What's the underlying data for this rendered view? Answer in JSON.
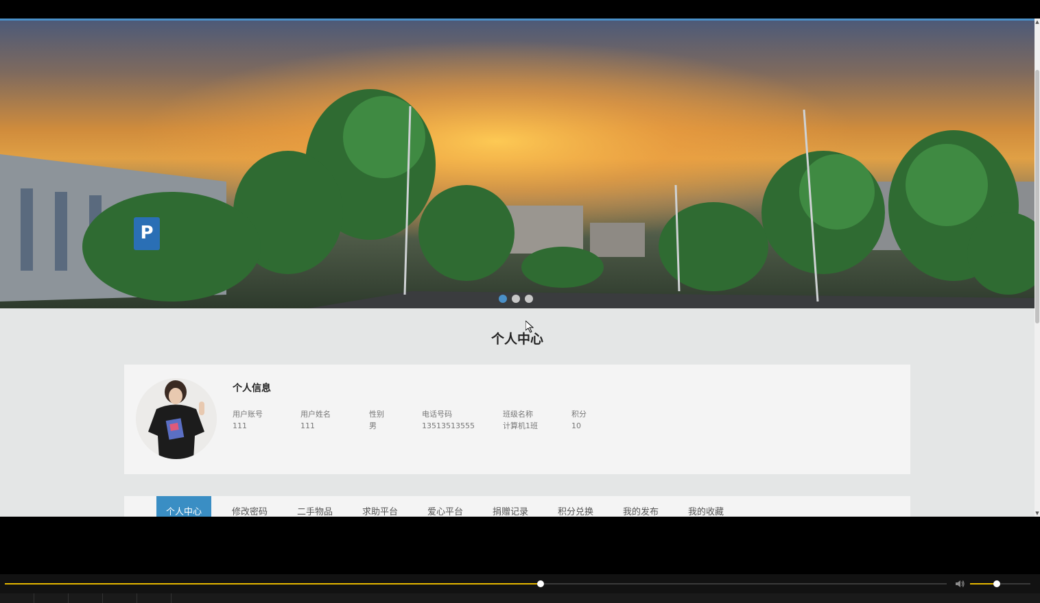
{
  "page": {
    "section_title": "个人中心",
    "carousel": {
      "slide_count": 3,
      "active_index": 0
    }
  },
  "profile": {
    "heading": "个人信息",
    "fields": [
      {
        "label": "用户账号",
        "value": "111"
      },
      {
        "label": "用户姓名",
        "value": "111"
      },
      {
        "label": "性别",
        "value": "男"
      },
      {
        "label": "电话号码",
        "value": "13513513555"
      },
      {
        "label": "班级名称",
        "value": "计算机1班"
      },
      {
        "label": "积分",
        "value": "10"
      }
    ]
  },
  "tabs": [
    {
      "label": "个人中心",
      "active": true
    },
    {
      "label": "修改密码",
      "active": false
    },
    {
      "label": "二手物品",
      "active": false
    },
    {
      "label": "求助平台",
      "active": false
    },
    {
      "label": "爱心平台",
      "active": false
    },
    {
      "label": "捐赠记录",
      "active": false
    },
    {
      "label": "积分兑换",
      "active": false
    },
    {
      "label": "我的发布",
      "active": false
    },
    {
      "label": "我的收藏",
      "active": false
    }
  ],
  "player": {
    "progress_fraction": 0.569,
    "volume_fraction": 0.44,
    "progress_color": "#e6b800",
    "volume_icon": "speaker-icon"
  },
  "colors": {
    "accent": "#3a8ec4",
    "page_bg": "#e4e6e6",
    "card_bg": "#f4f4f4"
  }
}
